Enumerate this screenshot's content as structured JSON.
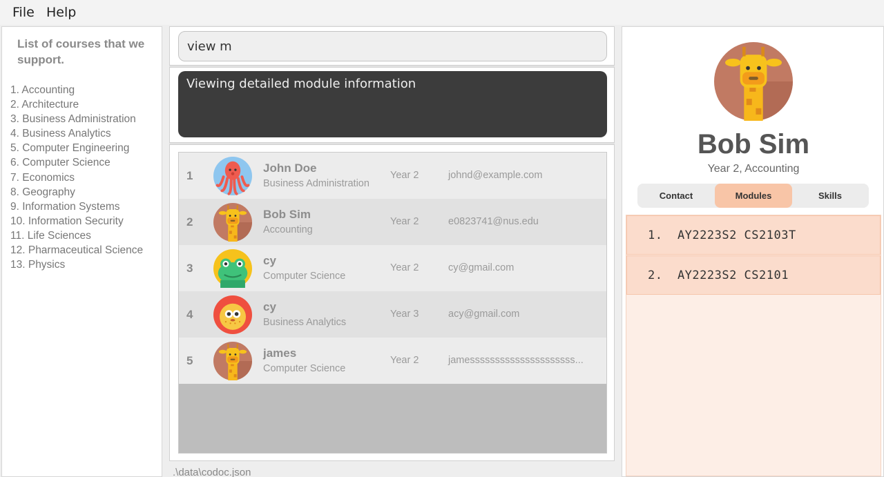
{
  "menu": {
    "file": "File",
    "help": "Help"
  },
  "courses": {
    "title": "List of courses that we support.",
    "items": [
      "1. Accounting",
      "2. Architecture",
      "3. Business Administration",
      "4. Business Analytics",
      "5. Computer Engineering",
      "6. Computer Science",
      "7. Economics",
      "8. Geography",
      "9. Information Systems",
      "10. Information Security",
      "11. Life Sciences",
      "12. Pharmaceutical Science",
      "13. Physics"
    ]
  },
  "command": {
    "value": "view m"
  },
  "result": {
    "text": "Viewing detailed module information"
  },
  "people": [
    {
      "index": "1",
      "name": "John Doe",
      "course": "Business Administration",
      "year": "Year 2",
      "email": "johnd@example.com",
      "avatar": "octopus-icon"
    },
    {
      "index": "2",
      "name": "Bob Sim",
      "course": "Accounting",
      "year": "Year 2",
      "email": "e0823741@nus.edu",
      "avatar": "giraffe-icon"
    },
    {
      "index": "3",
      "name": "cy",
      "course": "Computer Science",
      "year": "Year 2",
      "email": "cy@gmail.com",
      "avatar": "frog-icon"
    },
    {
      "index": "4",
      "name": "cy",
      "course": "Business Analytics",
      "year": "Year 3",
      "email": "acy@gmail.com",
      "avatar": "pufferfish-icon"
    },
    {
      "index": "5",
      "name": "james",
      "course": "Computer Science",
      "year": "Year 2",
      "email": "jamesssssssssssssssssssss...",
      "avatar": "giraffe-icon"
    }
  ],
  "status": {
    "path": ".\\data\\codoc.json"
  },
  "profile": {
    "name": "Bob Sim",
    "subtitle": "Year 2, Accounting",
    "avatar": "giraffe-icon",
    "tabs": [
      "Contact",
      "Modules",
      "Skills"
    ],
    "active_tab": "Modules",
    "modules": [
      "1.  AY2223S2 CS2103T",
      "2.  AY2223S2 CS2101"
    ]
  },
  "colors": {
    "accent": "#f8c5a7",
    "module_bg": "#fbdccc",
    "result_bg": "#3c3c3c"
  }
}
